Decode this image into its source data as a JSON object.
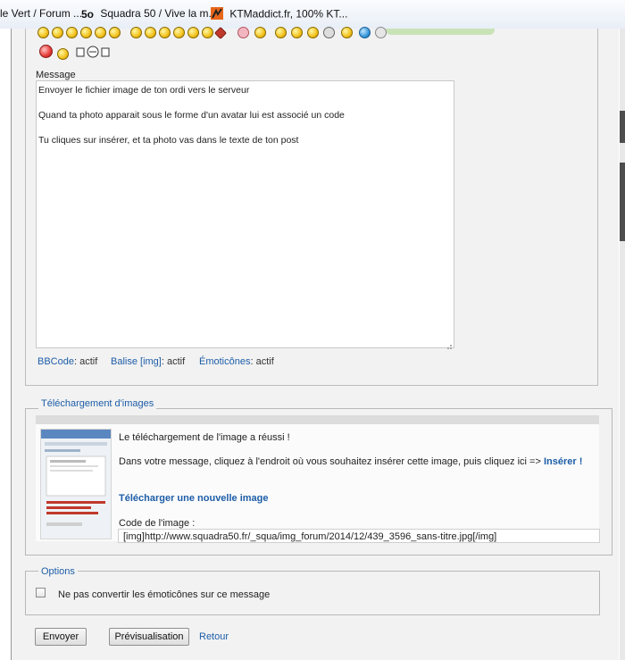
{
  "bookmarks": {
    "items": [
      {
        "label": "le Vert / Forum ..."
      },
      {
        "label": "Squadra 50 / Vive la m..."
      },
      {
        "label": "KTMaddict.fr, 100% KT..."
      }
    ],
    "squadra_logo": "5o"
  },
  "message": {
    "label": "Message",
    "lines": [
      "Envoyer le fichier image de ton ordi vers le serveur",
      "Quand ta photo apparait sous le forme d'un avatar lui est associé un code",
      "Tu cliques sur insérer, et ta photo vas dans le texte de ton post"
    ],
    "status": {
      "bbcode_label": "BBCode",
      "bbcode_value": ": actif",
      "img_label": "Balise [img]",
      "img_value": ": actif",
      "emoticons_label": "Émoticônes",
      "emoticons_value": ": actif"
    }
  },
  "upload": {
    "legend": "Téléchargement d'images",
    "success_text": "Le téléchargement de l'image a réussi !",
    "instructions_text": "Dans votre message, cliquez à l'endroit où vous souhaitez insérer cette image, puis cliquez ici =>",
    "insert_label": "Insérer !",
    "new_upload_label": "Télécharger une nouvelle image",
    "code_label": "Code de l'image :",
    "code_value": "[img]http://www.squadra50.fr/_squa/img_forum/2014/12/439_3596_sans-titre.jpg[/img]"
  },
  "options": {
    "legend": "Options",
    "no_emoticons_label": "Ne pas convertir les émoticônes sur ce message",
    "no_emoticons_checked": false
  },
  "actions": {
    "send_label": "Envoyer",
    "preview_label": "Prévisualisation",
    "back_label": "Retour"
  },
  "colors": {
    "link": "#1d5da8",
    "panel": "#f2f2f2",
    "bookmarks_bar": "#e8eef7"
  }
}
